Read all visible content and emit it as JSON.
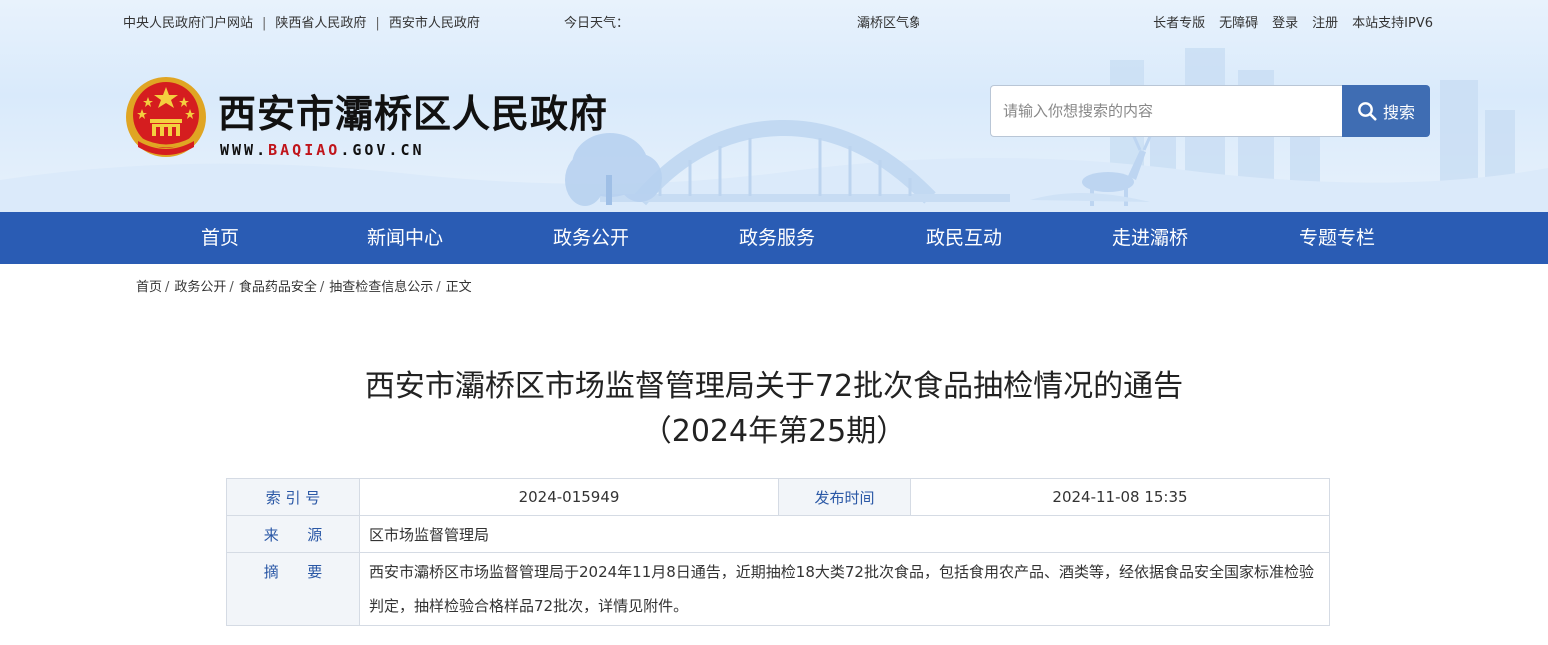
{
  "topbar": {
    "links": [
      "中央人民政府门户网站",
      "陕西省人民政府",
      "西安市人民政府"
    ],
    "separator": "|",
    "weather_label": "今日天气：",
    "weather_text": "灞桥区气象",
    "right_links": [
      "长者专版",
      "无障碍",
      "登录",
      "注册",
      "本站支持IPV6"
    ]
  },
  "header": {
    "site_title": "西安市灞桥区人民政府",
    "domain_prefix": "WWW.",
    "domain_highlight": "BAQIAO",
    "domain_suffix": ".GOV.CN",
    "search_placeholder": "请输入你想搜索的内容",
    "search_button": "搜索"
  },
  "nav": [
    "首页",
    "新闻中心",
    "政务公开",
    "政务服务",
    "政民互动",
    "走进灞桥",
    "专题专栏"
  ],
  "breadcrumb": {
    "items": [
      "首页",
      "政务公开",
      "食品药品安全",
      "抽查检查信息公示",
      "正文"
    ],
    "separator": "/"
  },
  "article": {
    "title_line1": "西安市灞桥区市场监督管理局关于72批次食品抽检情况的通告",
    "title_line2": "（2024年第25期）"
  },
  "meta": {
    "index_label": "索 引 号",
    "index_value": "2024-015949",
    "pubtime_label": "发布时间",
    "pubtime_value": "2024-11-08 15:35",
    "source_label": "来      源",
    "source_value": "区市场监督管理局",
    "summary_label": "摘      要",
    "summary_value": "西安市灞桥区市场监督管理局于2024年11月8日通告，近期抽检18大类72批次食品，包括食用农产品、酒类等，经依据食品安全国家标准检验判定，抽样检验合格样品72批次，详情见附件。"
  },
  "colors": {
    "nav_bg": "#2a5cb4",
    "search_button_bg": "#3f6db3",
    "meta_label": "#2b58a6",
    "domain_highlight": "#c0151b"
  }
}
